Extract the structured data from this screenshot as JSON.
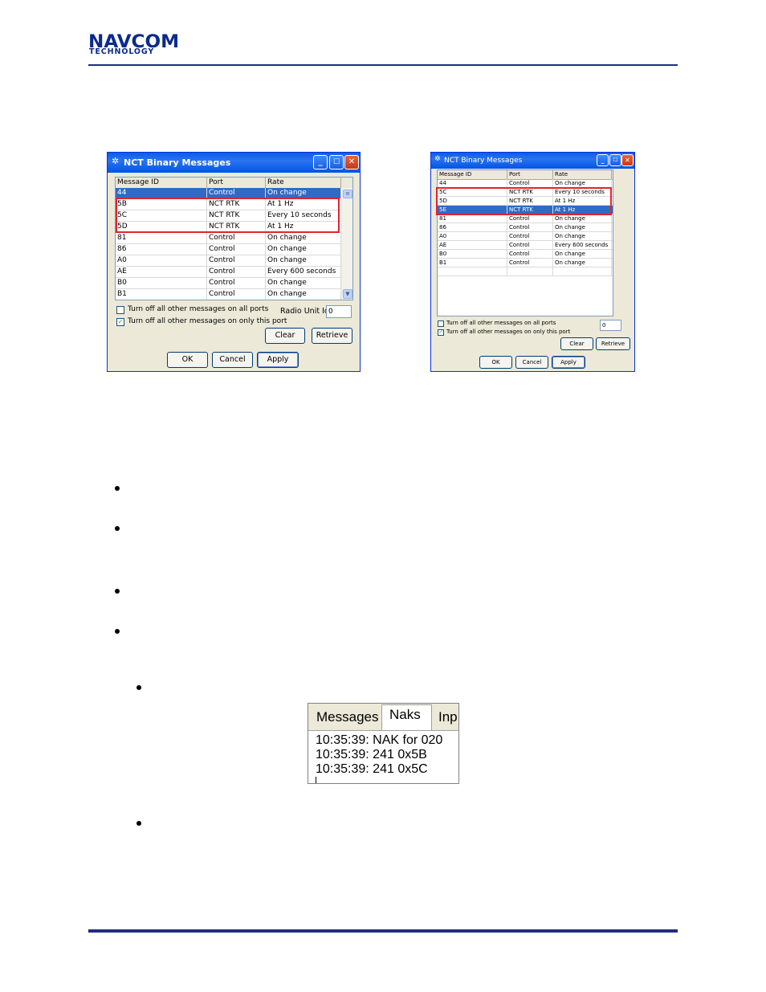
{
  "header": {
    "logo_line1": "NAVCOM",
    "logo_line2": "TECHNOLOGY"
  },
  "dialog_left": {
    "title": "NCT Binary Messages",
    "columns": [
      "Message ID",
      "Port",
      "Rate"
    ],
    "rows": [
      {
        "id": "44",
        "port": "Control",
        "rate": "On change",
        "selected": true
      },
      {
        "id": "5B",
        "port": "NCT RTK",
        "rate": "At 1 Hz"
      },
      {
        "id": "5C",
        "port": "NCT RTK",
        "rate": "Every 10 seconds"
      },
      {
        "id": "5D",
        "port": "NCT RTK",
        "rate": "At 1 Hz"
      },
      {
        "id": "81",
        "port": "Control",
        "rate": "On change"
      },
      {
        "id": "86",
        "port": "Control",
        "rate": "On change"
      },
      {
        "id": "A0",
        "port": "Control",
        "rate": "On change"
      },
      {
        "id": "AE",
        "port": "Control",
        "rate": "Every 600 seconds"
      },
      {
        "id": "B0",
        "port": "Control",
        "rate": "On change"
      },
      {
        "id": "B1",
        "port": "Control",
        "rate": "On change"
      }
    ],
    "checkbox_all_ports": {
      "label": "Turn off all other messages on all ports",
      "checked": false
    },
    "checkbox_this_port": {
      "label": "Turn off all other messages on only this port",
      "checked": true
    },
    "radio_unit_label": "Radio Unit Id:",
    "radio_unit_value": "0",
    "clear_label": "Clear",
    "retrieve_label": "Retrieve",
    "ok_label": "OK",
    "cancel_label": "Cancel",
    "apply_label": "Apply"
  },
  "dialog_right": {
    "title": "NCT Binary Messages",
    "columns": [
      "Message ID",
      "Port",
      "Rate"
    ],
    "rows": [
      {
        "id": "44",
        "port": "Control",
        "rate": "On change"
      },
      {
        "id": "5C",
        "port": "NCT RTK",
        "rate": "Every 10 seconds"
      },
      {
        "id": "5D",
        "port": "NCT RTK",
        "rate": "At 1 Hz"
      },
      {
        "id": "5E",
        "port": "NCT RTK",
        "rate": "At 1 Hz",
        "selected": true
      },
      {
        "id": "81",
        "port": "Control",
        "rate": "On change"
      },
      {
        "id": "86",
        "port": "Control",
        "rate": "On change"
      },
      {
        "id": "A0",
        "port": "Control",
        "rate": "On change"
      },
      {
        "id": "AE",
        "port": "Control",
        "rate": "Every 600 seconds"
      },
      {
        "id": "B0",
        "port": "Control",
        "rate": "On change"
      },
      {
        "id": "B1",
        "port": "Control",
        "rate": "On change"
      },
      {
        "id": "",
        "port": "",
        "rate": ""
      }
    ],
    "checkbox_all_ports": {
      "label": "Turn off all other messages on all ports",
      "checked": false
    },
    "checkbox_this_port": {
      "label": "Turn off all other messages on only this port",
      "checked": true
    },
    "radio_unit_value": "0",
    "clear_label": "Clear",
    "retrieve_label": "Retrieve",
    "ok_label": "OK",
    "cancel_label": "Cancel",
    "apply_label": "Apply"
  },
  "naks_panel": {
    "tabs": [
      "Messages",
      "Naks",
      "Inp"
    ],
    "active_tab": "Naks",
    "lines": [
      "10:35:39: NAK for 020",
      "10:35:39:   241 0x5B",
      "10:35:39:   241 0x5C"
    ]
  },
  "colors": {
    "brand_blue": "#1f2d7a",
    "highlight_red": "#e0242a",
    "selection_blue": "#316ac5"
  }
}
